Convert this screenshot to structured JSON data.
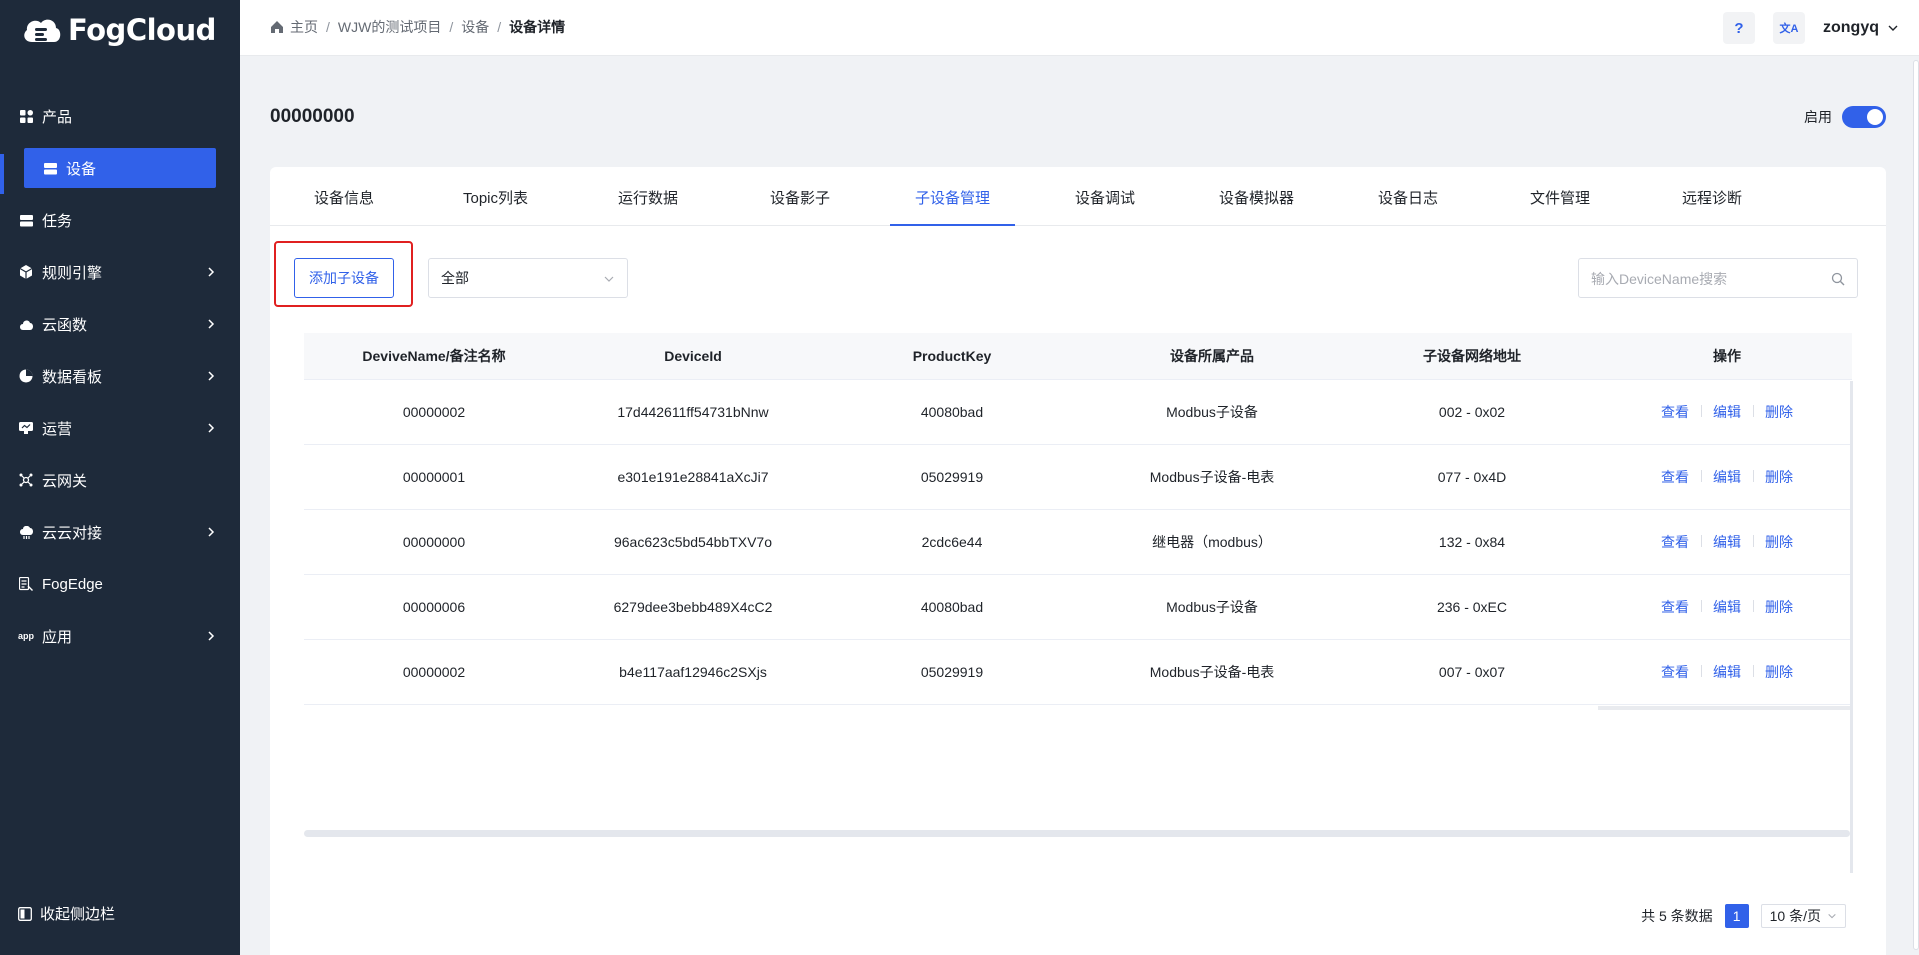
{
  "app": {
    "logo_text": "FogCloud"
  },
  "sidebar": {
    "items": [
      {
        "label": "产品",
        "icon": "grid-icon",
        "expandable": false
      },
      {
        "label": "设备",
        "icon": "device-icon",
        "expandable": false,
        "active": true
      },
      {
        "label": "任务",
        "icon": "task-icon",
        "expandable": false
      },
      {
        "label": "规则引擎",
        "icon": "cube-icon",
        "expandable": true
      },
      {
        "label": "云函数",
        "icon": "cloud-icon",
        "expandable": true
      },
      {
        "label": "数据看板",
        "icon": "pie-icon",
        "expandable": true
      },
      {
        "label": "运营",
        "icon": "operation-icon",
        "expandable": true
      },
      {
        "label": "云网关",
        "icon": "gateway-icon",
        "expandable": false
      },
      {
        "label": "云云对接",
        "icon": "cloud-link-icon",
        "expandable": true
      },
      {
        "label": "FogEdge",
        "icon": "edge-icon",
        "expandable": false
      },
      {
        "label": "应用",
        "icon": "app-icon",
        "expandable": true
      }
    ],
    "collapse_label": "收起侧边栏"
  },
  "header": {
    "breadcrumb": [
      "主页",
      "WJW的测试项目",
      "设备",
      "设备详情"
    ],
    "help_label": "?",
    "lang_label": "文A",
    "username": "zongyq"
  },
  "page": {
    "title": "00000000",
    "enable_label": "启用",
    "enabled": true
  },
  "tabs": [
    "设备信息",
    "Topic列表",
    "运行数据",
    "设备影子",
    "子设备管理",
    "设备调试",
    "设备模拟器",
    "设备日志",
    "文件管理",
    "远程诊断"
  ],
  "active_tab": "子设备管理",
  "toolbar": {
    "add_label": "添加子设备",
    "filter_value": "全部",
    "search_placeholder": "输入DeviceName搜索"
  },
  "table": {
    "columns": [
      "DeviveName/备注名称",
      "DeviceId",
      "ProductKey",
      "设备所属产品",
      "子设备网络地址",
      "操作"
    ],
    "rows": [
      {
        "name": "00000002",
        "id": "17d442611ff54731bNnw",
        "key": "40080bad",
        "product": "Modbus子设备",
        "addr": "002 - 0x02"
      },
      {
        "name": "00000001",
        "id": "e301e191e28841aXcJi7",
        "key": "05029919",
        "product": "Modbus子设备-电表",
        "addr": "077 - 0x4D"
      },
      {
        "name": "00000000",
        "id": "96ac623c5bd54bbTXV7o",
        "key": "2cdc6e44",
        "product": "继电器（modbus）",
        "addr": "132 - 0x84"
      },
      {
        "name": "00000006",
        "id": "6279dee3bebb489X4cC2",
        "key": "40080bad",
        "product": "Modbus子设备",
        "addr": "236 - 0xEC"
      },
      {
        "name": "00000002",
        "id": "b4e117aaf12946c2SXjs",
        "key": "05029919",
        "product": "Modbus子设备-电表",
        "addr": "007 - 0x07"
      }
    ],
    "actions": [
      "查看",
      "编辑",
      "删除"
    ]
  },
  "pagination": {
    "total_label": "共 5 条数据",
    "current_page": "1",
    "page_size_label": "10 条/页"
  },
  "colors": {
    "sidebar_bg": "#1e2a3a",
    "accent": "#3161e9",
    "highlight_border": "#e02020"
  }
}
